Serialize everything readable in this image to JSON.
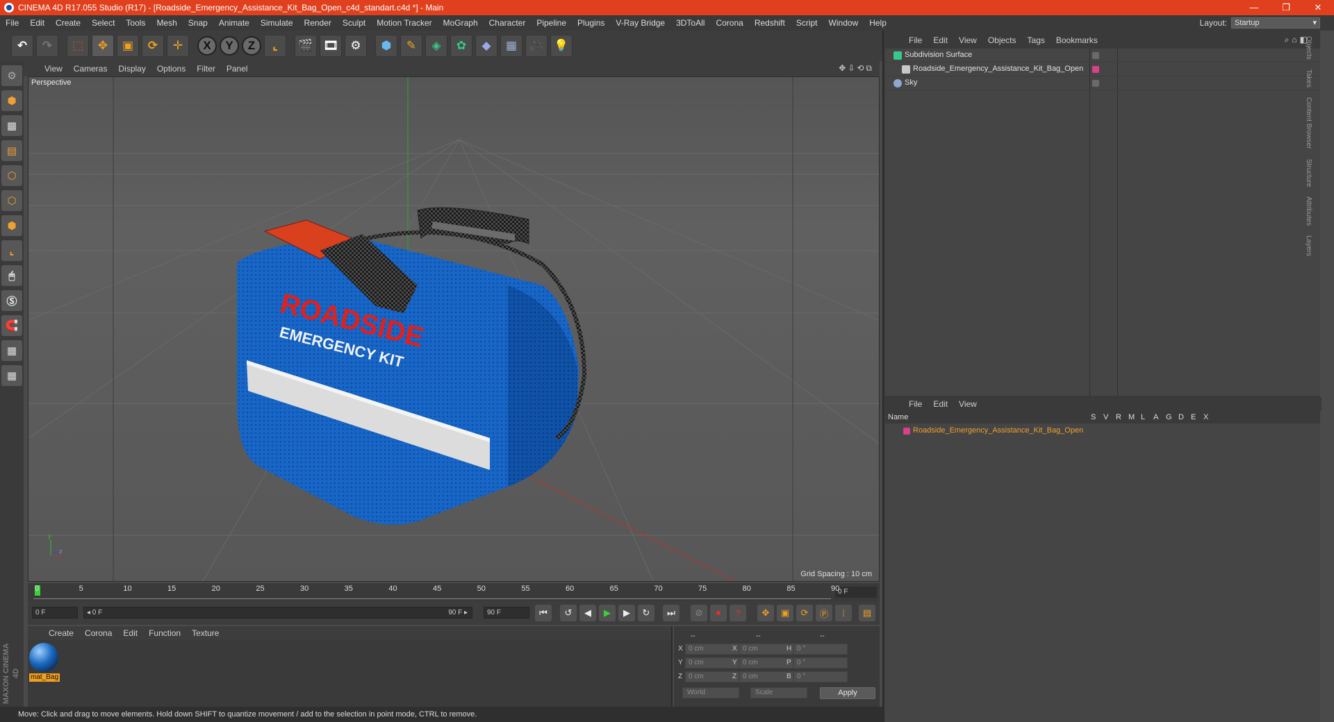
{
  "window": {
    "title": "CINEMA 4D R17.055 Studio (R17) - [Roadside_Emergency_Assistance_Kit_Bag_Open_c4d_standart.c4d *] - Main",
    "min": "—",
    "restore": "❐",
    "close": "✕"
  },
  "menu": [
    "File",
    "Edit",
    "Create",
    "Select",
    "Tools",
    "Mesh",
    "Snap",
    "Animate",
    "Simulate",
    "Render",
    "Sculpt",
    "Motion Tracker",
    "MoGraph",
    "Character",
    "Pipeline",
    "Plugins",
    "V-Ray Bridge",
    "3DToAll",
    "Corona",
    "Redshift",
    "Script",
    "Window",
    "Help"
  ],
  "layout": {
    "label": "Layout:",
    "value": "Startup"
  },
  "toolbar": {
    "x": "X",
    "y": "Y",
    "z": "Z"
  },
  "viewport": {
    "menu": [
      "View",
      "Cameras",
      "Display",
      "Options",
      "Filter",
      "Panel"
    ],
    "camera": "Perspective",
    "grid_spacing": "Grid Spacing : 10 cm",
    "bag_text_1": "ROADSIDE",
    "bag_text_2": "EMERGENCY KIT",
    "nav_icons": "✥⇩⟲⧉"
  },
  "timeline": {
    "ticks": [
      "0",
      "5",
      "10",
      "15",
      "20",
      "25",
      "30",
      "35",
      "40",
      "45",
      "50",
      "55",
      "60",
      "65",
      "70",
      "75",
      "80",
      "85",
      "90"
    ],
    "end_frame": "0 F"
  },
  "transport": {
    "current": "0 F",
    "range_start": "◂ 0 F",
    "range_end": "90 F ▸",
    "max": "90 F"
  },
  "material_manager": {
    "menu": [
      "Create",
      "Corona",
      "Edit",
      "Function",
      "Texture"
    ],
    "materials": [
      {
        "name": "mat_Bag"
      }
    ]
  },
  "coordinates": {
    "headers": [
      "--",
      "--",
      "--"
    ],
    "rows": [
      {
        "a": "X",
        "av": "0 cm",
        "b": "X",
        "bv": "0 cm",
        "c": "H",
        "cv": "0 °"
      },
      {
        "a": "Y",
        "av": "0 cm",
        "b": "Y",
        "bv": "0 cm",
        "c": "P",
        "cv": "0 °"
      },
      {
        "a": "Z",
        "av": "0 cm",
        "b": "Z",
        "bv": "0 cm",
        "c": "B",
        "cv": "0 °"
      }
    ],
    "mode1": "World",
    "mode2": "Scale",
    "apply": "Apply"
  },
  "status": "Move: Click and drag to move elements. Hold down SHIFT to quantize movement / add to the selection in point mode, CTRL to remove.",
  "brand": "MAXON CINEMA 4D",
  "object_manager": {
    "menu": [
      "File",
      "Edit",
      "View",
      "Objects",
      "Tags",
      "Bookmarks"
    ],
    "objects": [
      {
        "name": "Subdivision Surface",
        "icon_color": "#36c98a"
      },
      {
        "name": "Roadside_Emergency_Assistance_Kit_Bag_Open",
        "icon_color": "#c8c8c8",
        "tag_color": "#d8408a"
      },
      {
        "name": "Sky",
        "icon_color": "#8fa8d0"
      }
    ]
  },
  "layer_manager": {
    "menu": [
      "File",
      "Edit",
      "View"
    ],
    "columns": [
      "Name",
      "S",
      "V",
      "R",
      "M",
      "L",
      "A",
      "G",
      "D",
      "E",
      "X"
    ],
    "layers": [
      {
        "name": "Roadside_Emergency_Assistance_Kit_Bag_Open",
        "color": "#d8408a"
      }
    ]
  },
  "side_tabs": [
    "Objects",
    "Takes",
    "Content Browser",
    "Structure",
    "Attributes",
    "Layers"
  ]
}
